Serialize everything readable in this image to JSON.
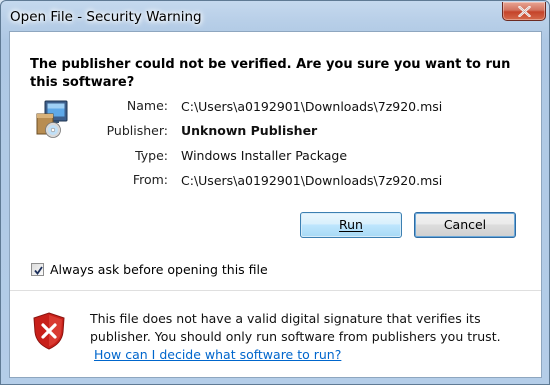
{
  "window": {
    "title": "Open File - Security Warning"
  },
  "heading": "The publisher could not be verified.  Are you sure you want to run this software?",
  "details": {
    "name_label": "Name:",
    "name_value": "C:\\Users\\a0192901\\Downloads\\7z920.msi",
    "publisher_label": "Publisher:",
    "publisher_value": "Unknown Publisher",
    "type_label": "Type:",
    "type_value": "Windows Installer Package",
    "from_label": "From:",
    "from_value": "C:\\Users\\a0192901\\Downloads\\7z920.msi"
  },
  "buttons": {
    "run_label": "Run",
    "cancel_label": "Cancel"
  },
  "checkbox": {
    "label": "Always ask before opening this file",
    "checked": true
  },
  "warning": {
    "text": "This file does not have a valid digital signature that verifies its publisher. You should only run software from publishers you trust.",
    "link": "How can I decide what software to run?"
  },
  "icons": {
    "installer": "installer-package-icon",
    "shield": "security-shield-icon",
    "close": "close-icon"
  },
  "colors": {
    "link": "#0066cc",
    "shield_red": "#c8201a",
    "close_red": "#c5432a"
  }
}
